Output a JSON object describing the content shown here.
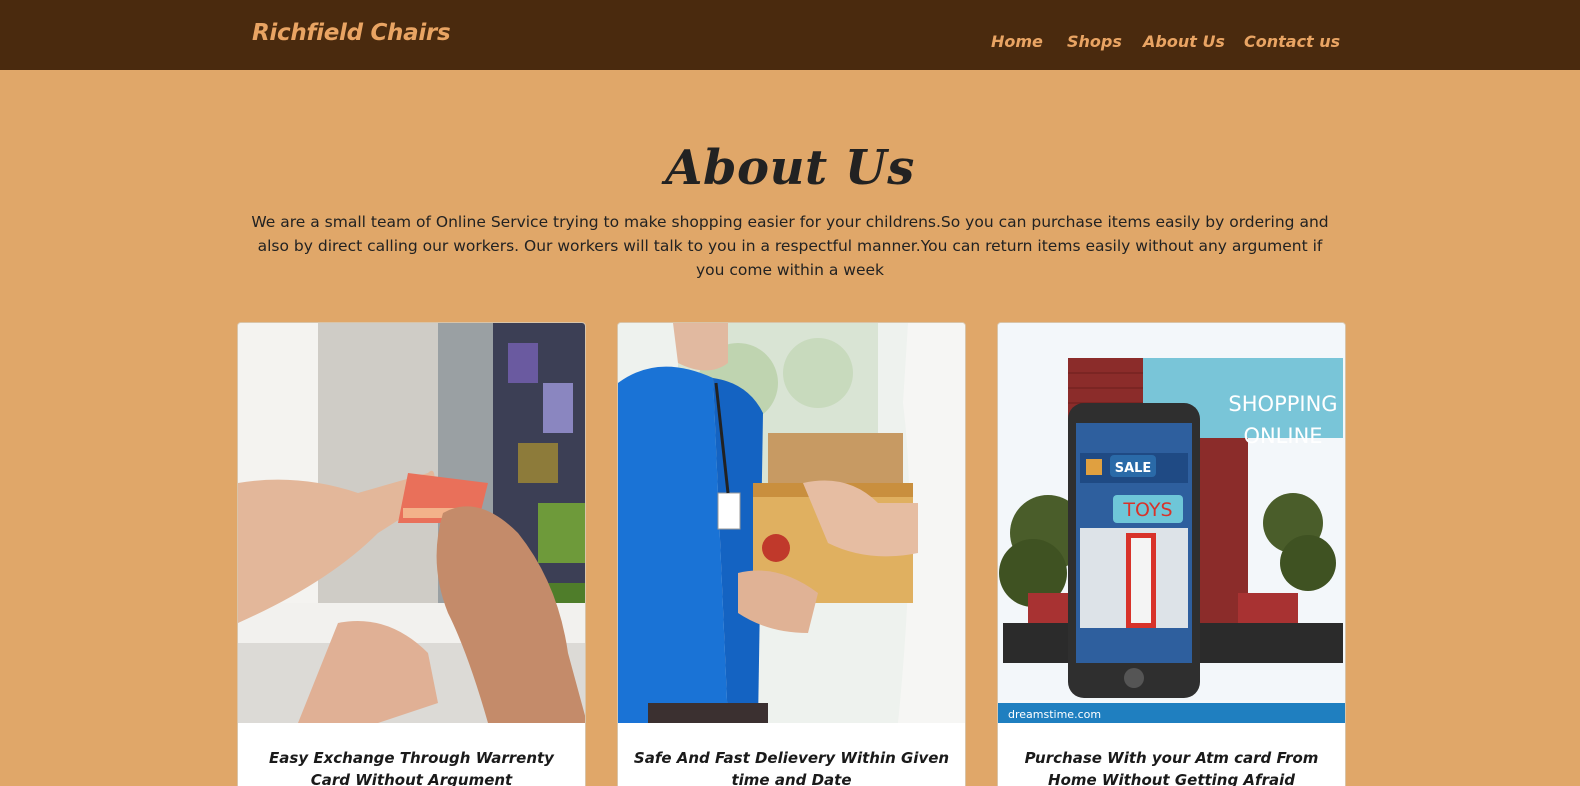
{
  "navbar": {
    "brand": "Richfield Chairs",
    "links": [
      {
        "label": "Home"
      },
      {
        "label": "Shops"
      },
      {
        "label": "About Us"
      },
      {
        "label": "Contact us"
      }
    ]
  },
  "about": {
    "heading": "About Us",
    "text": "We are a small team of Online Service trying to make shopping easier for your childrens.So you can purchase items easily by ordering and also by direct calling our workers. Our workers will talk to you in a respectful manner.You can return items easily without any argument if you come within a week"
  },
  "cards": [
    {
      "title": "Easy Exchange Through Warrenty Card Without Argument",
      "image": "card-payment-photo"
    },
    {
      "title": "Safe And Fast Delievery Within Given time and Date",
      "image": "package-delivery-photo"
    },
    {
      "title": "Purchase With your Atm card From Home Without Getting Afraid",
      "image": "shopping-online-illustration",
      "image_text": {
        "banner_line1": "SHOPPING",
        "banner_line2": "ONLINE",
        "sale": "SALE",
        "toys": "TOYS",
        "footer": "dreamstime.com"
      }
    }
  ],
  "colors": {
    "background": "#e0a769",
    "navbar": "#4a2a0e",
    "nav_text": "#e9a463",
    "card": "#ffffff"
  }
}
